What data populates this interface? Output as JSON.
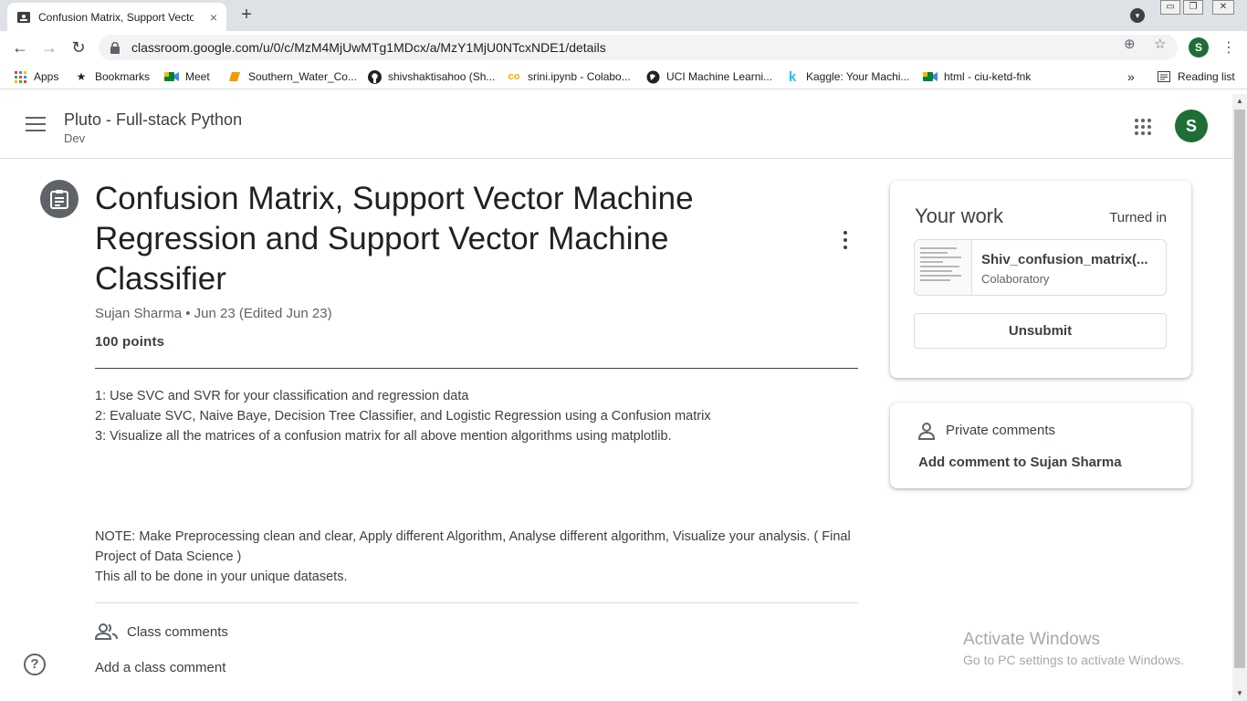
{
  "browser": {
    "tab_title": "Confusion Matrix, Support Vector Machine Regression and Support Vector Machine Classifier",
    "tab_close": "×",
    "new_tab": "+",
    "url": "classroom.google.com/u/0/c/MzM4MjUwMTg1MDcx/a/MzY1MjU0NTcxNDE1/details",
    "profile_initial": "S",
    "window_buttons": [
      "▭",
      "❐",
      "✕"
    ]
  },
  "bookmarks": [
    {
      "label": "Apps",
      "icon": "apps-grid-icon"
    },
    {
      "label": "Bookmarks",
      "icon": "star-icon"
    },
    {
      "label": "Meet",
      "icon": "meet-icon"
    },
    {
      "label": "Southern_Water_Co...",
      "icon": "folder-icon"
    },
    {
      "label": "shivshaktisahoo (Sh...",
      "icon": "github-icon"
    },
    {
      "label": "srini.ipynb - Colabo...",
      "icon": "colab-icon"
    },
    {
      "label": "UCI Machine Learni...",
      "icon": "globe-icon"
    },
    {
      "label": "Kaggle: Your Machi...",
      "icon": "kaggle-icon"
    },
    {
      "label": "html - ciu-ketd-fnk",
      "icon": "meet-icon"
    }
  ],
  "bookmarks_overflow": "»",
  "reading_list": "Reading list",
  "classroom": {
    "class_name": "Pluto - Full-stack Python",
    "section": "Dev",
    "avatar_initial": "S"
  },
  "assignment": {
    "title": "Confusion Matrix, Support Vector Machine Regression and Support Vector Machine Classifier",
    "meta": "Sujan Sharma • Jun 23 (Edited Jun 23)",
    "points": "100 points",
    "description": [
      "1: Use SVC and SVR for your classification and regression data",
      "2: Evaluate SVC, Naive Baye, Decision Tree Classifier, and Logistic Regression using a Confusion matrix",
      "3: Visualize all the matrices of a confusion matrix for all above mention algorithms using matplotlib."
    ],
    "note": [
      "NOTE: Make Preprocessing clean and clear, Apply different Algorithm, Analyse different algorithm, Visualize your analysis. ( Final Project of Data Science )",
      "This all to be done in your unique datasets."
    ],
    "class_comments_label": "Class comments",
    "add_class_comment": "Add a class comment"
  },
  "your_work": {
    "heading": "Your work",
    "status": "Turned in",
    "attachment_name": "Shiv_confusion_matrix(...",
    "attachment_type": "Colaboratory",
    "unsubmit_label": "Unsubmit"
  },
  "private_comments": {
    "heading": "Private comments",
    "add_label": "Add comment to Sujan Sharma"
  },
  "help_label": "?",
  "watermark": {
    "line1": "Activate Windows",
    "line2": "Go to PC settings to activate Windows."
  },
  "colors": {
    "accent_green": "#1e6e36",
    "icon_gray": "#5f6368",
    "text_dark": "#202124"
  }
}
